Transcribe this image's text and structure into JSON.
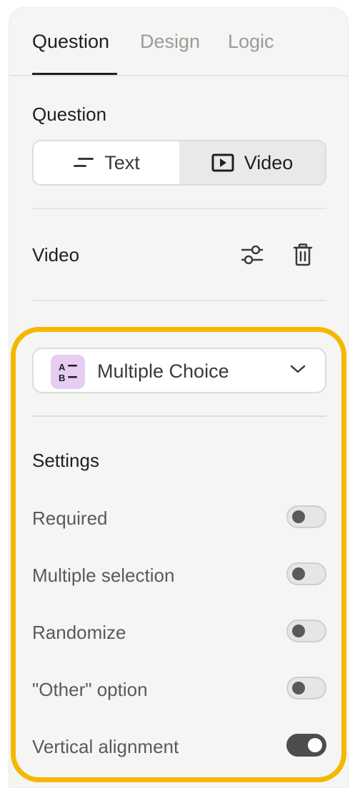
{
  "tabs": [
    {
      "label": "Question",
      "active": true
    },
    {
      "label": "Design",
      "active": false
    },
    {
      "label": "Logic",
      "active": false
    }
  ],
  "question_section": {
    "title": "Question",
    "options": [
      {
        "label": "Text",
        "icon": "text-lines-icon",
        "selected": false
      },
      {
        "label": "Video",
        "icon": "video-play-icon",
        "selected": true
      }
    ]
  },
  "video_row": {
    "label": "Video",
    "actions": [
      "sliders-icon",
      "trash-icon"
    ]
  },
  "question_type": {
    "label": "Multiple Choice",
    "badge_text": [
      "A",
      "B"
    ],
    "badge_color": "#e7ccf3",
    "icon": "chevron-down-icon"
  },
  "settings": {
    "title": "Settings",
    "items": [
      {
        "label": "Required",
        "on": false
      },
      {
        "label": "Multiple selection",
        "on": false
      },
      {
        "label": "Randomize",
        "on": false
      },
      {
        "label": "\"Other\" option",
        "on": false
      },
      {
        "label": "Vertical alignment",
        "on": true
      }
    ]
  },
  "colors": {
    "highlight": "#f5b800",
    "panel_bg": "#f5f5f3",
    "toggle_on": "#4d4d4b"
  }
}
